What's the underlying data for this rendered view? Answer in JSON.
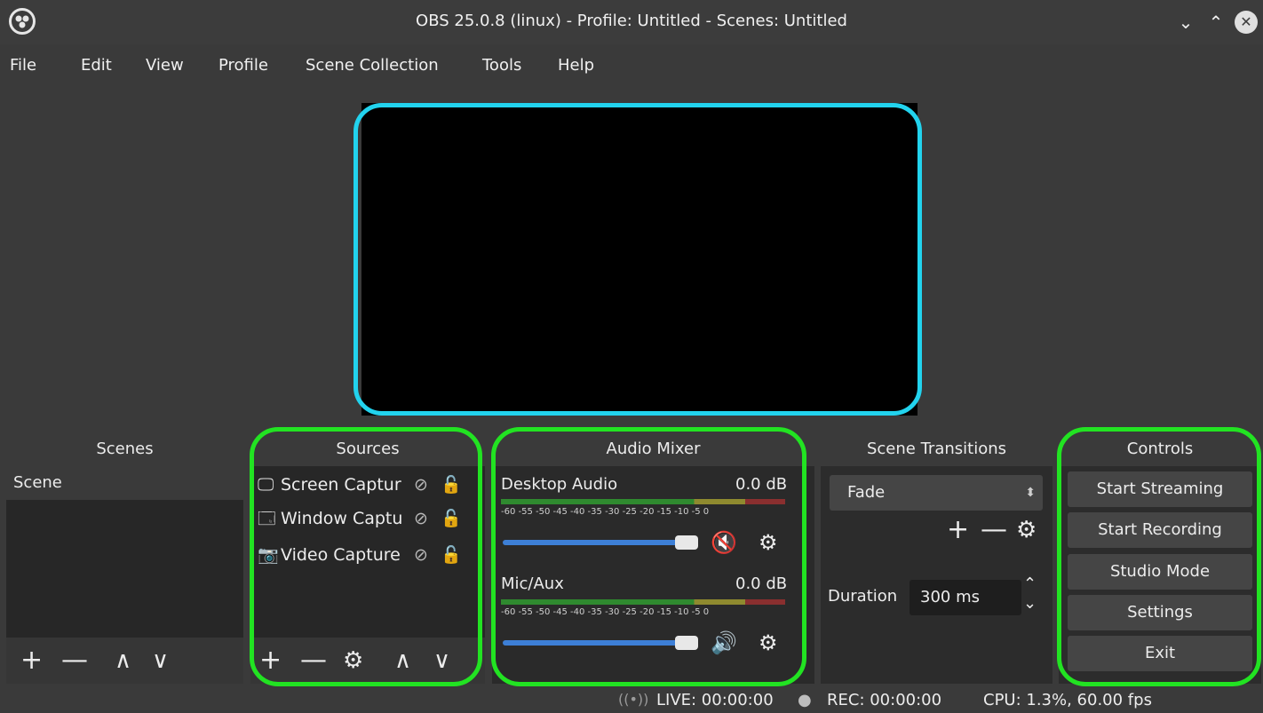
{
  "window": {
    "title": "OBS 25.0.8 (linux) - Profile: Untitled - Scenes: Untitled",
    "minimize_glyph": "⌄",
    "maximize_glyph": "⌃",
    "close_glyph": "✕"
  },
  "menu": [
    "File",
    "Edit",
    "View",
    "Profile",
    "Scene Collection",
    "Tools",
    "Help"
  ],
  "docks": {
    "scenes": {
      "title": "Scenes",
      "items": [
        "Scene"
      ]
    },
    "sources": {
      "title": "Sources",
      "items": [
        {
          "name": "Screen Captur",
          "icon": "monitor-icon"
        },
        {
          "name": "Window Captu",
          "icon": "window-icon"
        },
        {
          "name": "Video Capture",
          "icon": "camera-icon"
        }
      ]
    },
    "audio_mixer": {
      "title": "Audio Mixer",
      "scale": "-60 -55 -50 -45 -40 -35 -30 -25 -20 -15 -10 -5 0",
      "channels": [
        {
          "name": "Desktop Audio",
          "level": "0.0 dB",
          "muted": true,
          "volume_fraction": 0.9
        },
        {
          "name": "Mic/Aux",
          "level": "0.0 dB",
          "muted": false,
          "volume_fraction": 0.9
        }
      ]
    },
    "transitions": {
      "title": "Scene Transitions",
      "selected": "Fade",
      "duration_label": "Duration",
      "duration_value": "300 ms"
    },
    "controls": {
      "title": "Controls",
      "buttons": [
        "Start Streaming",
        "Start Recording",
        "Studio Mode",
        "Settings",
        "Exit"
      ]
    }
  },
  "status": {
    "live": "LIVE: 00:00:00",
    "rec": "REC: 00:00:00",
    "cpu": "CPU: 1.3%, 60.00 fps"
  },
  "colors": {
    "highlight_preview": "#22d3ee",
    "highlight_docks": "#22e322",
    "volume_bar": "#3d7fd6",
    "mute_red": "#e02020"
  }
}
